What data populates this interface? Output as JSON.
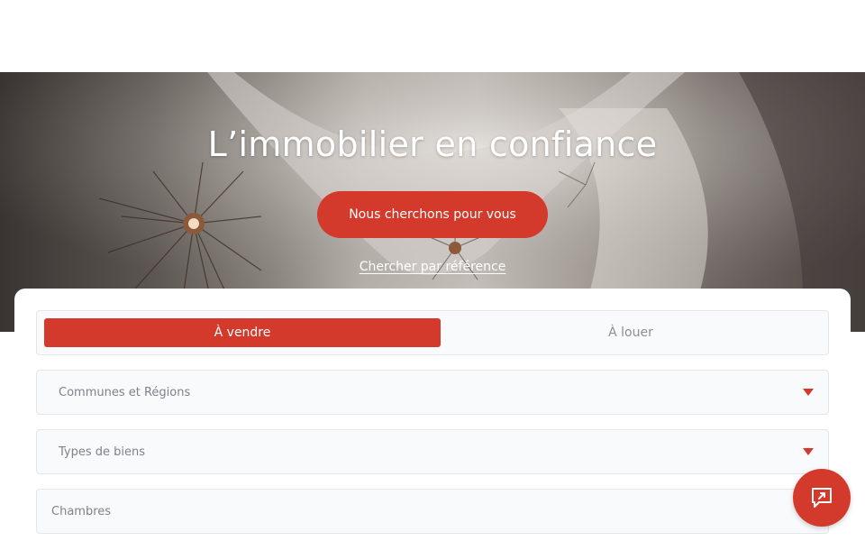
{
  "hero": {
    "title": "L’immobilier en confiance",
    "cta_label": "Nous cherchons pour vous",
    "reference_link": "Chercher par référence"
  },
  "search": {
    "tabs": [
      {
        "label": "À vendre",
        "active": true
      },
      {
        "label": "À louer",
        "active": false
      }
    ],
    "fields": {
      "communes": "Communes et Régions",
      "types": "Types de biens",
      "chambres": "Chambres"
    }
  },
  "icons": {
    "caret": "chevron-down-icon",
    "chat": "external-chat-icon"
  },
  "colors": {
    "accent": "#d33a2c",
    "field_bg": "#f8fafc",
    "field_border": "#e3e6ea",
    "muted_text": "#7d838b"
  }
}
